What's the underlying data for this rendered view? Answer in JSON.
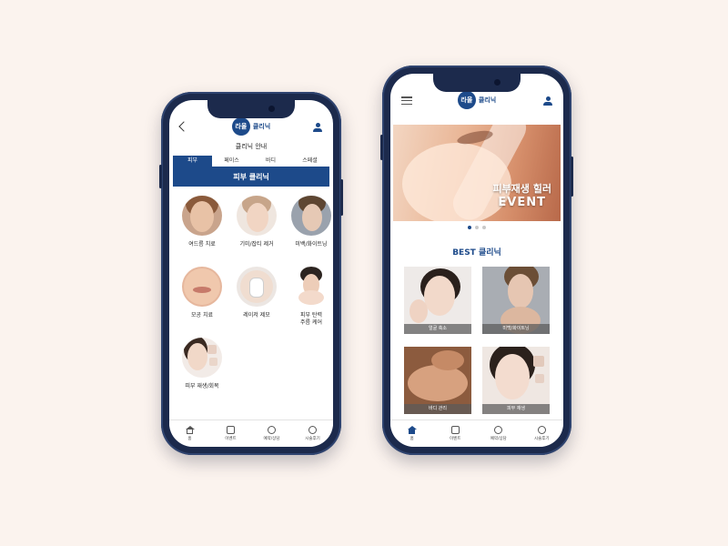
{
  "colors": {
    "brand": "#1d4a8a",
    "frame": "#1c2a4c",
    "background": "#fbf3ee"
  },
  "logo": {
    "badge": "라올",
    "text": "클리닉"
  },
  "left_screen": {
    "subtitle": "클리닉 안내",
    "tabs": [
      {
        "label": "피부",
        "active": true
      },
      {
        "label": "페이스",
        "active": false
      },
      {
        "label": "바디",
        "active": false
      },
      {
        "label": "스페셜",
        "active": false
      }
    ],
    "section_title": "피부 클리닉",
    "items": [
      {
        "label": "여드름 치료"
      },
      {
        "label": "기미/잡티 제거"
      },
      {
        "label": "미백/화이트닝"
      },
      {
        "label": "모공 치료"
      },
      {
        "label": "레이저 제모"
      },
      {
        "label": "피부 탄력\n주름 케어"
      },
      {
        "label": "피부 재생/회복"
      }
    ]
  },
  "right_screen": {
    "banner": {
      "line1": "피부재생 힐러",
      "line2": "EVENT"
    },
    "carousel": {
      "count": 3,
      "active": 0
    },
    "best_title": "BEST 클리닉",
    "cards": [
      {
        "label": "얼굴 축소"
      },
      {
        "label": "미백/화이트닝"
      },
      {
        "label": "바디 관리"
      },
      {
        "label": "피부 재생"
      }
    ]
  },
  "bottom_nav": [
    {
      "label": "홈",
      "icon": "home-icon"
    },
    {
      "label": "이벤트",
      "icon": "calendar-icon"
    },
    {
      "label": "예약/상담",
      "icon": "headset-icon"
    },
    {
      "label": "시술후기",
      "icon": "smile-icon"
    }
  ]
}
